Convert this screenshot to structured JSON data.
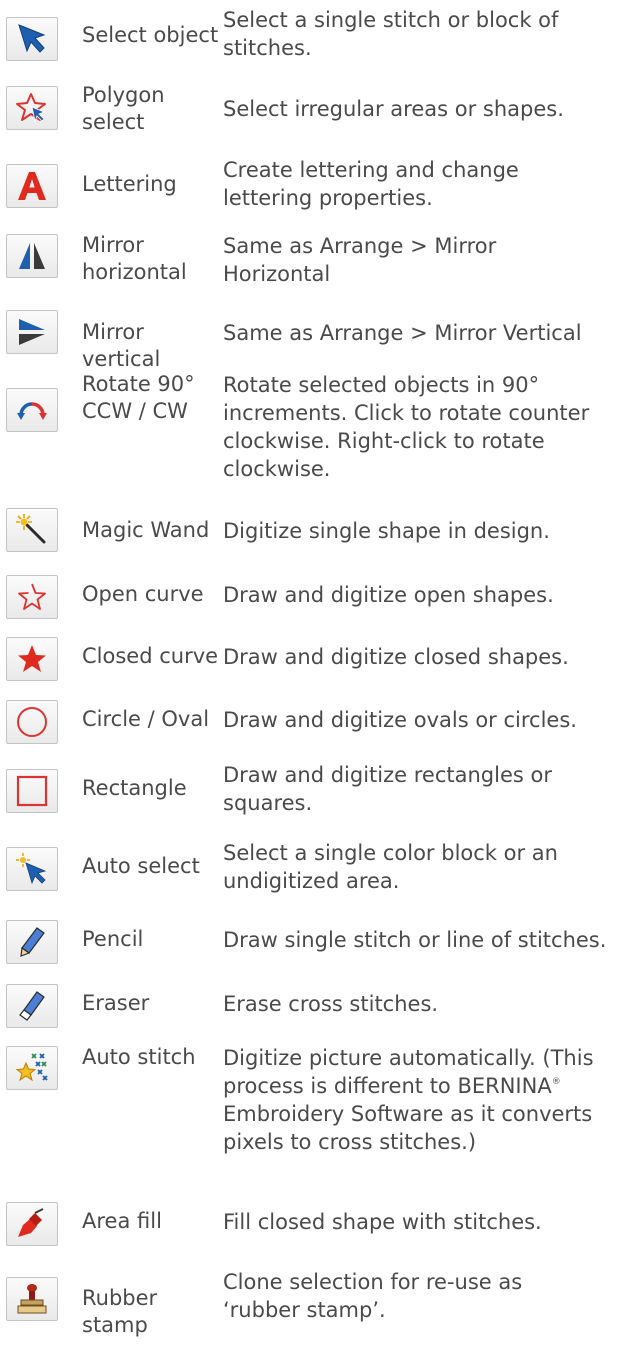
{
  "tools": [
    {
      "icon": "select-arrow-icon",
      "name": [
        "Select object"
      ],
      "desc": [
        "Select a single stitch or block of",
        "stitches."
      ]
    },
    {
      "icon": "polygon-star-icon",
      "name": [
        "Polygon",
        "select"
      ],
      "desc": [
        "Select irregular areas or shapes."
      ]
    },
    {
      "icon": "lettering-a-icon",
      "name": [
        "Lettering"
      ],
      "desc": [
        "Create lettering and change",
        "lettering properties."
      ]
    },
    {
      "icon": "mirror-horizontal-icon",
      "name": [
        "Mirror",
        "horizontal"
      ],
      "desc": [
        "Same as Arrange > Mirror",
        "Horizontal"
      ]
    },
    {
      "icon": "mirror-vertical-icon",
      "name": [
        "Mirror vertical"
      ],
      "desc": [
        "Same as Arrange > Mirror Vertical"
      ]
    },
    {
      "icon": "rotate-arrows-icon",
      "name": [
        "Rotate 90°",
        "CCW / CW"
      ],
      "desc": [
        "Rotate selected objects in 90°",
        "increments. Click to rotate counter",
        "clockwise. Right-click to rotate",
        "clockwise."
      ]
    },
    {
      "icon": "magic-wand-icon",
      "name": [
        "Magic Wand"
      ],
      "desc": [
        "Digitize single shape in design."
      ]
    },
    {
      "icon": "open-star-icon",
      "name": [
        "Open curve"
      ],
      "desc": [
        "Draw and digitize open shapes."
      ]
    },
    {
      "icon": "filled-star-icon",
      "name": [
        "Closed curve"
      ],
      "desc": [
        "Draw and digitize closed shapes."
      ]
    },
    {
      "icon": "circle-icon",
      "name": [
        "Circle / Oval"
      ],
      "desc": [
        "Draw and digitize ovals or circles."
      ]
    },
    {
      "icon": "rectangle-icon",
      "name": [
        "Rectangle"
      ],
      "desc": [
        "Draw and digitize rectangles or",
        "squares."
      ]
    },
    {
      "icon": "auto-select-wand-icon",
      "name": [
        "Auto select"
      ],
      "desc": [
        "Select a single color block or an",
        "undigitized area."
      ]
    },
    {
      "icon": "pencil-icon",
      "name": [
        "Pencil"
      ],
      "desc": [
        "Draw single stitch or line of stitches."
      ]
    },
    {
      "icon": "eraser-icon",
      "name": [
        "Eraser"
      ],
      "desc": [
        "Erase cross stitches."
      ]
    },
    {
      "icon": "auto-stitch-icon",
      "name": [
        "Auto stitch"
      ],
      "desc": [
        "Digitize picture automatically. (This",
        "process is different to BERNINA",
        "Embroidery Software as it converts",
        "pixels to cross stitches.)"
      ],
      "desc_sup": "®"
    },
    {
      "icon": "paint-bucket-icon",
      "name": [
        "Area fill"
      ],
      "desc": [
        "Fill closed shape with stitches."
      ]
    },
    {
      "icon": "rubber-stamp-icon",
      "name": [
        "Rubber stamp"
      ],
      "desc": [
        "Clone selection for re-use as",
        "‘rubber stamp’."
      ]
    }
  ]
}
